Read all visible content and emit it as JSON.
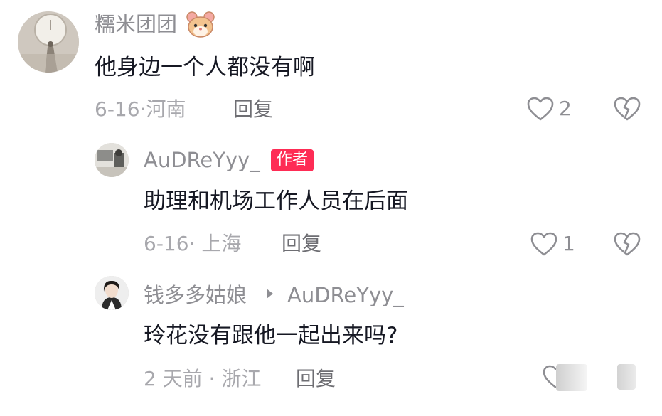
{
  "comments": [
    {
      "username": "糯米团团",
      "emoji_icon": "hamster-icon",
      "text": "他身边一个人都没有啊",
      "meta": "6-16·河南",
      "reply_label": "回复",
      "likes": "2"
    },
    {
      "username": "AuDReYyy_",
      "badge": "作者",
      "text": "助理和机场工作人员在后面",
      "meta": "6-16· 上海",
      "reply_label": "回复",
      "likes": "1"
    },
    {
      "username": "钱多多姑娘",
      "reply_to": "AuDReYyy_",
      "text": "玲花没有跟他一起出来吗?",
      "meta": "2 天前 · 浙江",
      "reply_label": "回复"
    }
  ],
  "colors": {
    "badge": "#fe2c55",
    "username": "#8e8e93",
    "text": "#161823",
    "meta": "#a8a8ad"
  }
}
